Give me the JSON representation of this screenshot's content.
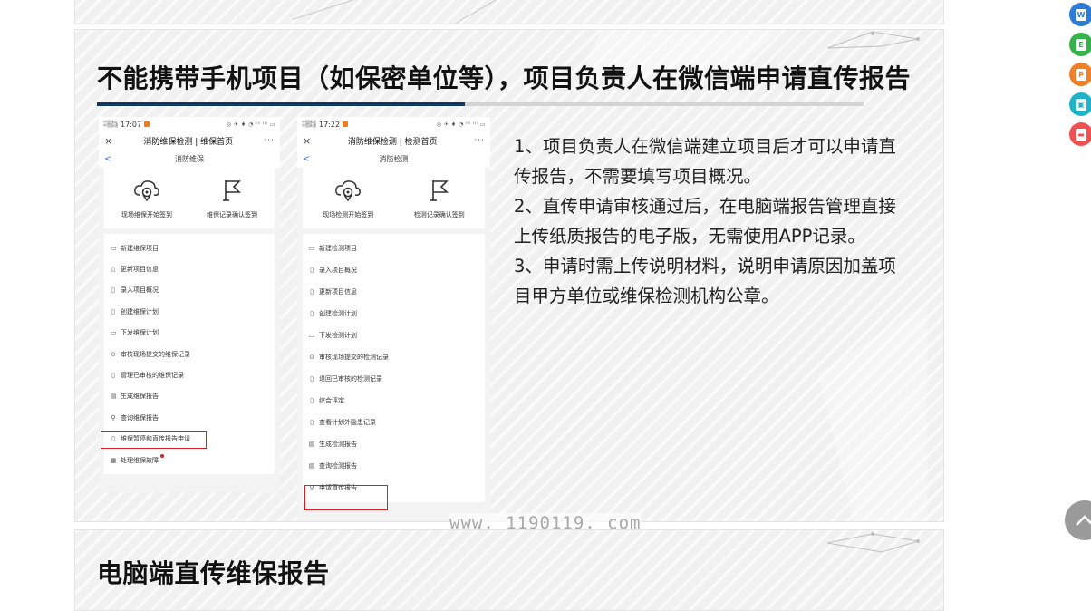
{
  "section_main": {
    "title": "不能携带手机项目（如保密单位等），项目负责人在微信端申请直传报告",
    "body": [
      "1、项目负责人在微信端建立项目后才可以申请直传报告，不需要填写项目概况。",
      "2、直传申请审核通过后，在电脑端报告管理直接上传纸质报告的电子版，无需使用APP记录。",
      "3、申请时需上传说明材料，说明申请原因加盖项目甲方单位或维保检测机构公章。"
    ]
  },
  "section_next": {
    "title": "电脑端直传维保报告"
  },
  "watermark": "www. 1190119. com",
  "phone1": {
    "carrier": "中国移动\n中国联通",
    "time": "17:07",
    "status_icons": "◎ ✈ ♦ ◔ ᵗᴵˡ ᵗᴵˡ ▭",
    "close": "×",
    "more": "···",
    "nav_title": "消防维保检测 | 维保首页",
    "back": "<",
    "sub_title": "消防维保",
    "btn_left": "现场维保开始签到",
    "btn_right": "维保记录确认签到",
    "menu": [
      {
        "icon": "▭",
        "label": "新建维保项目"
      },
      {
        "icon": "▯",
        "label": "更新项目信息"
      },
      {
        "icon": "▯",
        "label": "录入项目概况"
      },
      {
        "icon": "▯",
        "label": "创建维保计划"
      },
      {
        "icon": "▭",
        "label": "下发维保计划"
      },
      {
        "icon": "⊙",
        "label": "审核现场提交的维保记录"
      },
      {
        "icon": "▯",
        "label": "管理已审核的维保记录"
      },
      {
        "icon": "▤",
        "label": "生成维保报告"
      },
      {
        "icon": "⚲",
        "label": "查询维保报告"
      },
      {
        "icon": "▯",
        "label": "维保暂停和直传报告申请"
      },
      {
        "icon": "▦",
        "label": "处理维保故障"
      }
    ]
  },
  "phone2": {
    "carrier": "中国移动\n中国联通",
    "time": "17:22",
    "status_icons": "◎ ✈ ♦ ◔ ᵗᴵˡ ᵗᴵˡ ▭",
    "close": "×",
    "more": "···",
    "nav_title": "消防维保检测 | 检测首页",
    "back": "<",
    "sub_title": "消防检测",
    "btn_left": "现场检测开始签到",
    "btn_right": "检测记录确认签到",
    "menu": [
      {
        "icon": "▭",
        "label": "新建检测项目"
      },
      {
        "icon": "▯",
        "label": "录入项目概况"
      },
      {
        "icon": "▯",
        "label": "更新项目信息"
      },
      {
        "icon": "▯",
        "label": "创建检测计划"
      },
      {
        "icon": "▭",
        "label": "下发检测计划"
      },
      {
        "icon": "⊙",
        "label": "审核现场提交的检测记录"
      },
      {
        "icon": "▯",
        "label": "退回已审核的检测记录"
      },
      {
        "icon": "▯",
        "label": "综合评定"
      },
      {
        "icon": "▯",
        "label": "查看计划外隐患记录"
      },
      {
        "icon": "▤",
        "label": "生成检测报告"
      },
      {
        "icon": "▤",
        "label": "查询检测报告"
      },
      {
        "icon": "⚲",
        "label": "申请直传报告"
      }
    ]
  },
  "side_icons": [
    {
      "name": "word-icon",
      "letter": "W",
      "color": "#2b7bd9"
    },
    {
      "name": "excel-icon",
      "letter": "E",
      "color": "#36b24a"
    },
    {
      "name": "ppt-icon",
      "letter": "P",
      "color": "#f07f2a"
    },
    {
      "name": "image-icon",
      "letter": "▣",
      "color": "#1fb3c7"
    },
    {
      "name": "print-icon",
      "letter": "▬",
      "color": "#ef5050"
    }
  ],
  "colors": {
    "title_accent": "#12365e",
    "highlight_red": "#d42121",
    "link_blue": "#3b7be0"
  }
}
